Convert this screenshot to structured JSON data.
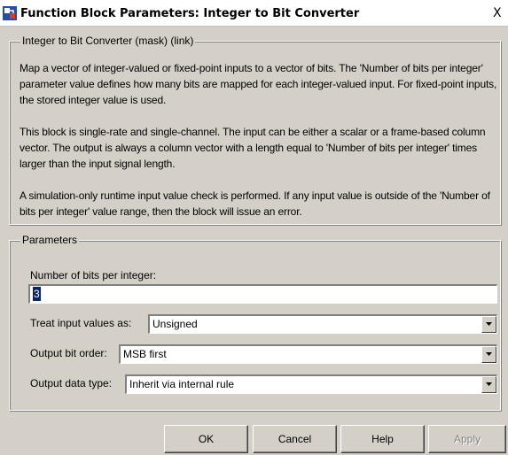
{
  "window": {
    "title": "Function Block Parameters: Integer to Bit Converter",
    "close_label": "X"
  },
  "description": {
    "legend": "Integer to Bit Converter (mask) (link)",
    "paragraphs": [
      "Map a vector of integer-valued or fixed-point inputs to a vector of bits. The 'Number of bits per integer' parameter value defines how many bits are mapped for each integer-valued input. For fixed-point inputs, the stored integer value is used.",
      "This block is single-rate and single-channel. The input can be either a scalar or a frame-based column vector. The output is always a column vector with a length equal to 'Number of bits per integer' times larger than the input signal length.",
      "A simulation-only runtime input value check is performed. If any input value is outside of the 'Number of bits per integer' value range, then the block will issue an error."
    ]
  },
  "parameters": {
    "legend": "Parameters",
    "bits_label": "Number of bits per integer:",
    "bits_value": "3",
    "treat_label": "Treat input values as:",
    "treat_value": "Unsigned",
    "order_label": "Output bit order:",
    "order_value": "MSB first",
    "dtype_label": "Output data type:",
    "dtype_value": "Inherit via internal rule"
  },
  "buttons": {
    "ok": "OK",
    "cancel": "Cancel",
    "help": "Help",
    "apply": "Apply"
  },
  "colors": {
    "dialog_bg": "#d4d0c8",
    "selection": "#0a246a"
  }
}
